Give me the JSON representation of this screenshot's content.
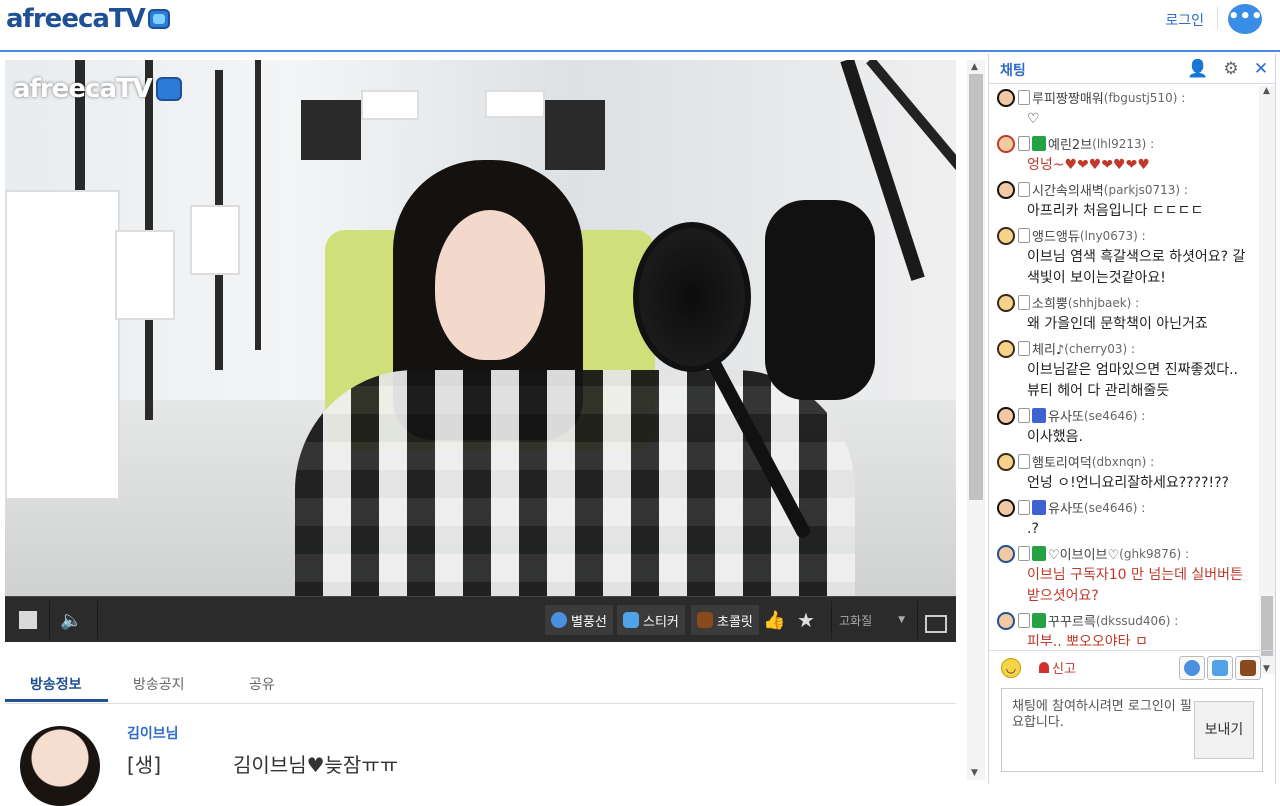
{
  "header": {
    "logo": "afreecaTV",
    "login": "로그인"
  },
  "player": {
    "watermark": "afreecaTV",
    "controls": {
      "balloon": "별풍선",
      "sticker": "스티커",
      "chocolate": "초콜릿",
      "quality": "고화질"
    }
  },
  "tabs": [
    {
      "label": "방송정보"
    },
    {
      "label": "방송공지"
    },
    {
      "label": "공유"
    }
  ],
  "broadcaster": {
    "name": "김이브님",
    "status": "[생]",
    "title": "김이브님♥늦잠ㅠㅠ"
  },
  "chat": {
    "title": "채팅",
    "messages": [
      {
        "nick": "루피짱짱매워",
        "id": "(fbgustj510) :",
        "text": "♡",
        "red": false,
        "badges": []
      },
      {
        "nick": "예린2브",
        "id": "(lhl9213) :",
        "text": "엉넝~♥❤♥❤♥❤♥",
        "red": true,
        "badges": [
          "fan"
        ]
      },
      {
        "nick": "시간속의새벽",
        "id": "(parkjs0713) :",
        "text": "아프리카 처음입니다 ㄷㄷㄷㄷ",
        "red": false,
        "badges": []
      },
      {
        "nick": "앵드앵듀",
        "id": "(lny0673) :",
        "text": "이브님 염색 흑갈색으로 하셧어요? 갈색빛이 보이는것같아요!",
        "red": false,
        "badges": []
      },
      {
        "nick": "소희뿡",
        "id": "(shhjbaek) :",
        "text": "왜 가을인데 문학책이 아닌거죠",
        "red": false,
        "badges": []
      },
      {
        "nick": "체리♪",
        "id": "(cherry03) :",
        "text": "이브님같은 엄마있으면 진짜좋겠다.. 뷰티 헤어 다 관리해줄듯",
        "red": false,
        "badges": []
      },
      {
        "nick": "유사또",
        "id": "(se4646) :",
        "text": "이사했음.",
        "red": false,
        "badges": [
          "sub"
        ]
      },
      {
        "nick": "햄토리여덕",
        "id": "(dbxnqn) :",
        "text": "언넝 ㅇ!언니요리잘하세요????!??",
        "red": false,
        "badges": []
      },
      {
        "nick": "유사또",
        "id": "(se4646) :",
        "text": ".?",
        "red": false,
        "badges": [
          "sub"
        ]
      },
      {
        "nick": "♡이브이브♡",
        "id": "(ghk9876) :",
        "text": "이브님 구독자10 만 넘는데 실버버튼 받으셧어요?",
        "red": true,
        "badges": [
          "fan"
        ]
      },
      {
        "nick": "꾸꾸르륵",
        "id": "(dkssud406) :",
        "text": "피부.. 뽀오오야타 ㅁ",
        "red": true,
        "badges": [
          "fan"
        ]
      }
    ],
    "report": "신고",
    "input_placeholder": "채팅에 참여하시려면 로그인이 필요합니다.",
    "send": "보내기"
  },
  "colors": {
    "brand": "#1f4f95",
    "accent": "#2e6cc9",
    "fan_badge": "#25a243",
    "sub_badge": "#3d63d1",
    "red_text": "#c0392b"
  }
}
